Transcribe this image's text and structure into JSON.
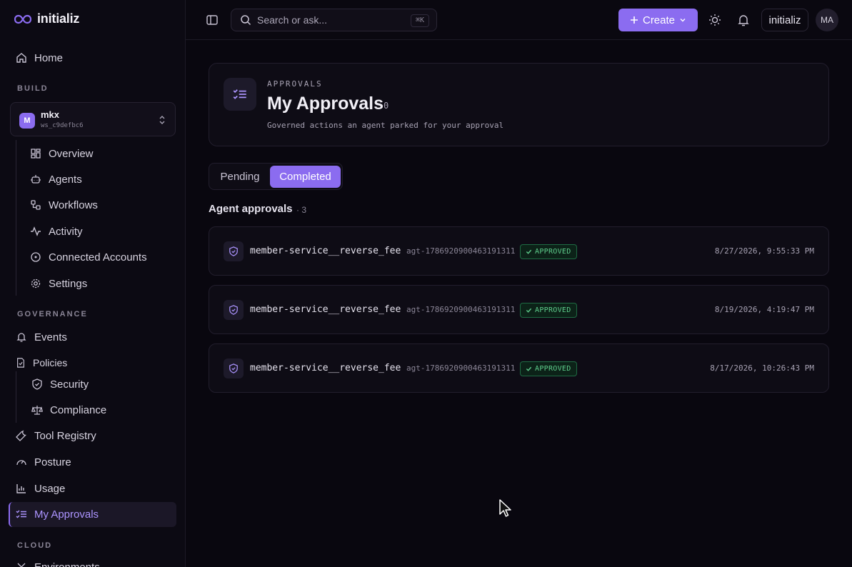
{
  "brand": {
    "name": "initializ"
  },
  "sidebar": {
    "home": "Home",
    "build_label": "BUILD",
    "workspace": {
      "initial": "M",
      "name": "mkx",
      "id": "ws_c9defbc6"
    },
    "build_items": [
      "Overview",
      "Agents",
      "Workflows",
      "Activity",
      "Connected Accounts",
      "Settings"
    ],
    "governance_label": "GOVERNANCE",
    "events": "Events",
    "policies": "Policies",
    "policy_items": [
      "Security",
      "Compliance"
    ],
    "tool_registry": "Tool Registry",
    "posture": "Posture",
    "usage": "Usage",
    "my_approvals": "My Approvals",
    "cloud_label": "CLOUD",
    "environments": "Environments"
  },
  "topbar": {
    "search_placeholder": "Search or ask...",
    "search_shortcut": "⌘K",
    "create_label": "Create",
    "org_label": "initializ",
    "user_initials": "MA"
  },
  "header": {
    "eyebrow": "APPROVALS",
    "title": "My Approvals",
    "count": "0",
    "subtitle": "Governed actions an agent parked for your approval"
  },
  "tabs": {
    "pending": "Pending",
    "completed": "Completed",
    "active": "completed"
  },
  "list": {
    "title": "Agent approvals",
    "count": "· 3",
    "rows": [
      {
        "name": "member-service__reverse_fee",
        "agent": "agt-1786920900463191311",
        "status": "APPROVED",
        "time": "8/27/2026, 9:55:33 PM"
      },
      {
        "name": "member-service__reverse_fee",
        "agent": "agt-1786920900463191311",
        "status": "APPROVED",
        "time": "8/19/2026, 4:19:47 PM"
      },
      {
        "name": "member-service__reverse_fee",
        "agent": "agt-1786920900463191311",
        "status": "APPROVED",
        "time": "8/17/2026, 10:26:43 PM"
      }
    ]
  },
  "colors": {
    "accent": "#8b6cf0",
    "approved": "#5fcf8d",
    "background": "#09070f"
  }
}
